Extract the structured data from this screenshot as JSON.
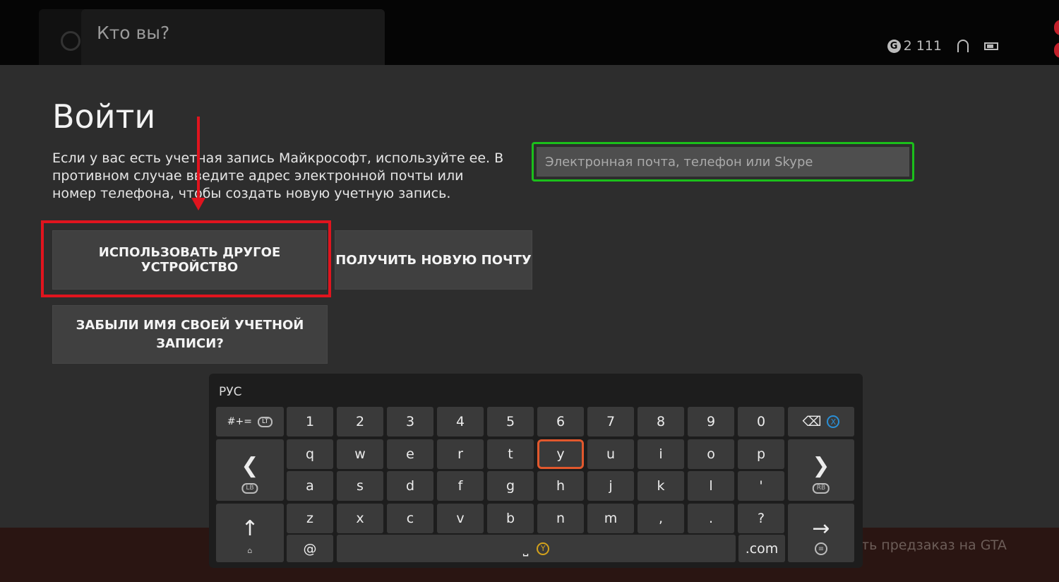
{
  "header": {
    "who_label": "Кто вы?",
    "gamerscore": "2 111",
    "gamerscore_badge": "G"
  },
  "signin": {
    "title": "Войти",
    "description": "Если у вас есть учетная запись Майкрософт, используйте ее. В противном случае введите адрес электронной почты или номер телефона, чтобы создать новую учетную запись.",
    "email_placeholder": "Электронная почта, телефон или Skype",
    "email_value": "",
    "use_other_device": "ИСПОЛЬЗОВАТЬ ДРУГОЕ УСТРОЙСТВО",
    "get_new_email": "ПОЛУЧИТЬ НОВУЮ ПОЧТУ",
    "forgot_account": "ЗАБЫЛИ ИМЯ СВОЕЙ УЧЕТНОЙ ЗАПИСИ?"
  },
  "background": {
    "promo_text": "ть предзаказ на GTA"
  },
  "keyboard": {
    "language": "РУС",
    "symbols_key": "#+=",
    "symbols_hint": "LT",
    "row_numbers": [
      "1",
      "2",
      "3",
      "4",
      "5",
      "6",
      "7",
      "8",
      "9",
      "0"
    ],
    "row_top": [
      "q",
      "w",
      "e",
      "r",
      "t",
      "y",
      "u",
      "i",
      "o",
      "p"
    ],
    "row_mid": [
      "a",
      "s",
      "d",
      "f",
      "g",
      "h",
      "j",
      "k",
      "l",
      "'"
    ],
    "row_bottom": [
      "z",
      "x",
      "c",
      "v",
      "b",
      "n",
      "m",
      ",",
      ".",
      "?"
    ],
    "at_key": "@",
    "space_key": "⎵",
    "space_hint": "Y",
    "dotcom_key": ".com",
    "backspace_key": "⌫",
    "backspace_hint": "X",
    "left_key": "❮",
    "left_hint": "LB",
    "right_key": "❯",
    "right_hint": "RB",
    "shift_key": "↑",
    "enter_key": "→",
    "enter_hint": "≡",
    "focused_key": "y"
  },
  "colors": {
    "highlight": "#e0141e",
    "focus_field": "#1bbf1b",
    "focus_key": "#e2582d"
  }
}
